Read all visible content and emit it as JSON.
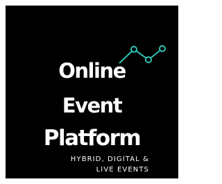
{
  "logo": {
    "title_lines": [
      "Online",
      "Event",
      "Platform"
    ],
    "tagline_lines": [
      "HYBRID, DIGITAL &",
      "LIVE EVENTS"
    ],
    "icon": "trend-line-icon",
    "colors": {
      "background": "#000000",
      "text": "#ffffff",
      "accent": "#2ec4b6"
    }
  }
}
